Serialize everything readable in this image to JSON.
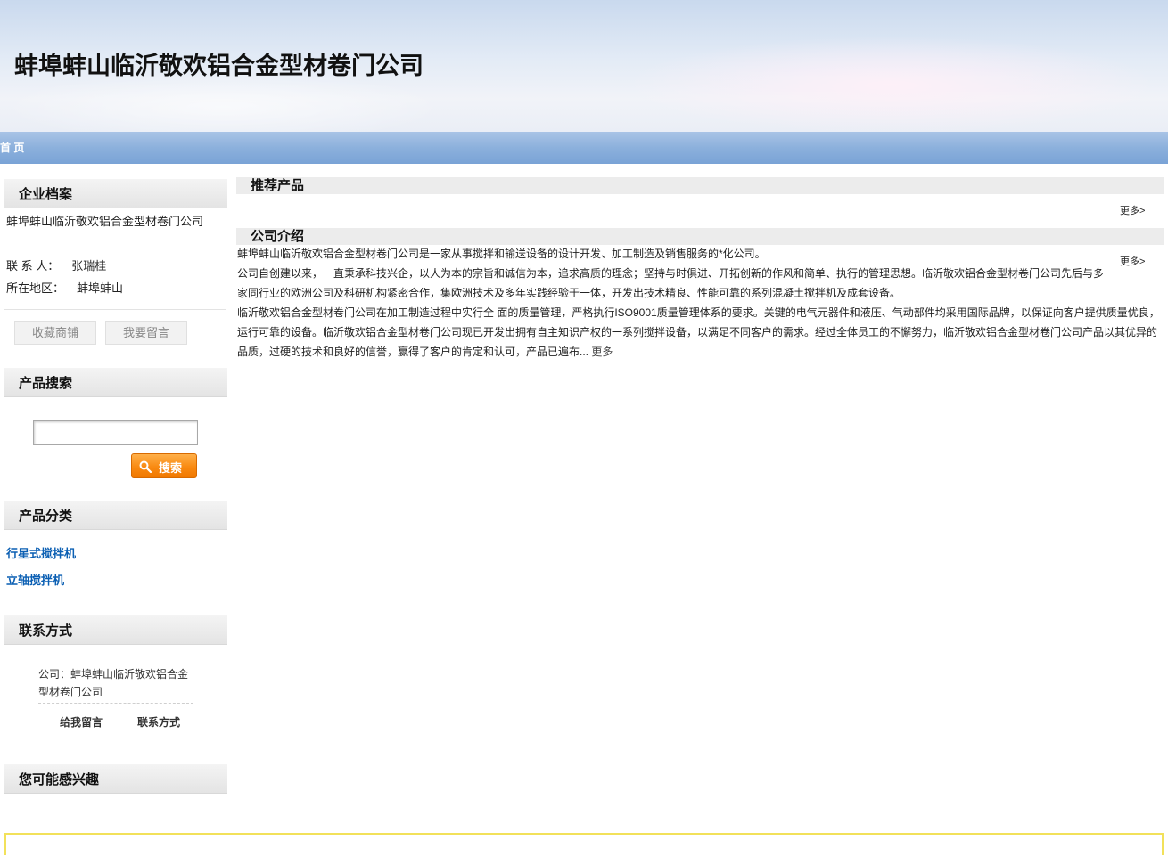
{
  "header": {
    "title": "蚌埠蚌山临沂敬欢铝合金型材卷门公司"
  },
  "nav": {
    "home": "首 页"
  },
  "sidebar": {
    "profile": {
      "heading": "企业档案",
      "company_name": "蚌埠蚌山临沂敬欢铝合金型材卷门公司",
      "contact_label": "联 系 人：",
      "contact_value": "张瑞桂",
      "region_label": "所在地区：",
      "region_value": "蚌埠蚌山",
      "favorite_button": "收藏商铺",
      "message_button": "我要留言"
    },
    "search": {
      "heading": "产品搜索",
      "input_value": "",
      "button": "搜索"
    },
    "categories": {
      "heading": "产品分类",
      "items": [
        "行星式搅拌机",
        "立轴搅拌机"
      ]
    },
    "contact": {
      "heading": "联系方式",
      "company": "公司：蚌埠蚌山临沂敬欢铝合金型材卷门公司",
      "leave_message": "给我留言",
      "contact_info": "联系方式"
    },
    "interest": {
      "heading": "您可能感兴趣"
    }
  },
  "main": {
    "recommended": {
      "heading": "推荐产品",
      "more": "更多>"
    },
    "intro": {
      "heading": "公司介绍",
      "more": "更多>",
      "paragraphs": [
        "蚌埠蚌山临沂敬欢铝合金型材卷门公司是一家从事搅拌和输送设备的设计开发、加工制造及销售服务的*化公司。",
        "公司自创建以来，一直秉承科技兴企，以人为本的宗旨和诚信为本，追求高质的理念；坚持与时俱进、开拓创新的作风和简单、执行的管理思想。临沂敬欢铝合金型材卷门公司先后与多家同行业的欧洲公司及科研机构紧密合作，集欧洲技术及多年实践经验于一体，开发出技术精良、性能可靠的系列混凝土搅拌机及成套设备。",
        "临沂敬欢铝合金型材卷门公司在加工制造过程中实行全 面的质量管理，严格执行ISO9001质量管理体系的要求。关键的电气元器件和液压、气动部件均采用国际品牌，以保证向客户提供质量优良，运行可靠的设备。临沂敬欢铝合金型材卷门公司现已开发出拥有自主知识产权的一系列搅拌设备，以满足不同客户的需求。经过全体员工的不懈努力，临沂敬欢铝合金型材卷门公司产品以其优异的品质，过硬的技术和良好的信誉，赢得了客户的肯定和认可，产品已遍布..."
      ],
      "inline_more": "更多"
    }
  }
}
